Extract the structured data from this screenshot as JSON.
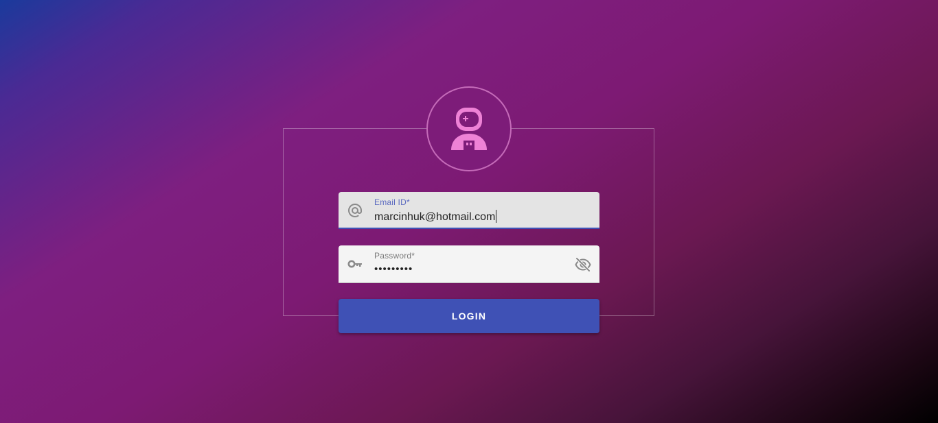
{
  "login_form": {
    "avatar_icon": "astronaut-icon",
    "email": {
      "label": "Email ID*",
      "value": "marcinhuk@hotmail.com",
      "icon": "at-sign-icon"
    },
    "password": {
      "label": "Password*",
      "value": "•••••••••",
      "icon": "key-icon",
      "toggle_icon": "eye-off-icon"
    },
    "login_button": "LOGIN"
  },
  "colors": {
    "accent": "#3f51b5",
    "avatar_pink": "#ee82d6",
    "icon_gray": "#8a8a8a"
  }
}
